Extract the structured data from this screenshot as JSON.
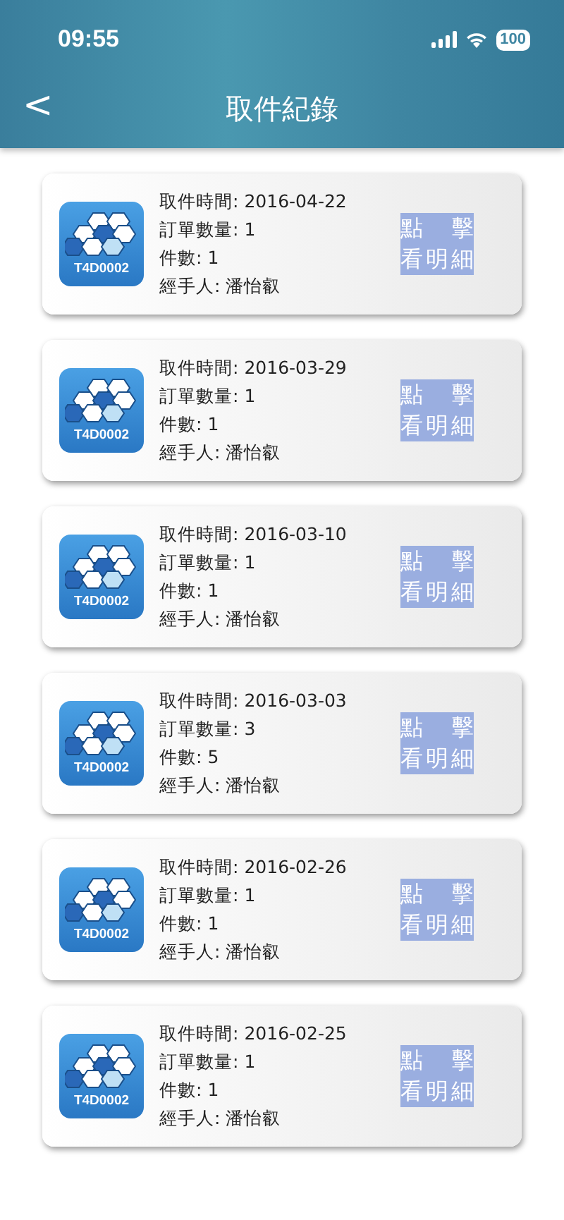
{
  "status_bar": {
    "time": "09:55",
    "battery": "100"
  },
  "nav": {
    "back": "<",
    "title": "取件紀錄"
  },
  "records": [
    {
      "badge": "T4D0002",
      "fields": [
        {
          "label": "取件時間:",
          "value": "2016-04-22"
        },
        {
          "label": "訂單數量:",
          "value": "1"
        },
        {
          "label": "件數:",
          "value": "1"
        },
        {
          "label": "經手人:",
          "value": "潘怡叡"
        }
      ],
      "button": [
        "點 擊",
        "看明細"
      ]
    },
    {
      "badge": "T4D0002",
      "fields": [
        {
          "label": "取件時間:",
          "value": "2016-03-29"
        },
        {
          "label": "訂單數量:",
          "value": "1"
        },
        {
          "label": "件數:",
          "value": "1"
        },
        {
          "label": "經手人:",
          "value": "潘怡叡"
        }
      ],
      "button": [
        "點 擊",
        "看明細"
      ]
    },
    {
      "badge": "T4D0002",
      "fields": [
        {
          "label": "取件時間:",
          "value": "2016-03-10"
        },
        {
          "label": "訂單數量:",
          "value": "1"
        },
        {
          "label": "件數:",
          "value": "1"
        },
        {
          "label": "經手人:",
          "value": "潘怡叡"
        }
      ],
      "button": [
        "點 擊",
        "看明細"
      ]
    },
    {
      "badge": "T4D0002",
      "fields": [
        {
          "label": "取件時間:",
          "value": "2016-03-03"
        },
        {
          "label": "訂單數量:",
          "value": "3"
        },
        {
          "label": "件數:",
          "value": "5"
        },
        {
          "label": "經手人:",
          "value": "潘怡叡"
        }
      ],
      "button": [
        "點 擊",
        "看明細"
      ]
    },
    {
      "badge": "T4D0002",
      "fields": [
        {
          "label": "取件時間:",
          "value": "2016-02-26"
        },
        {
          "label": "訂單數量:",
          "value": "1"
        },
        {
          "label": "件數:",
          "value": "1"
        },
        {
          "label": "經手人:",
          "value": "潘怡叡"
        }
      ],
      "button": [
        "點 擊",
        "看明細"
      ]
    },
    {
      "badge": "T4D0002",
      "fields": [
        {
          "label": "取件時間:",
          "value": "2016-02-25"
        },
        {
          "label": "訂單數量:",
          "value": "1"
        },
        {
          "label": "件數:",
          "value": "1"
        },
        {
          "label": "經手人:",
          "value": "潘怡叡"
        }
      ],
      "button": [
        "點 擊",
        "看明細"
      ]
    }
  ]
}
